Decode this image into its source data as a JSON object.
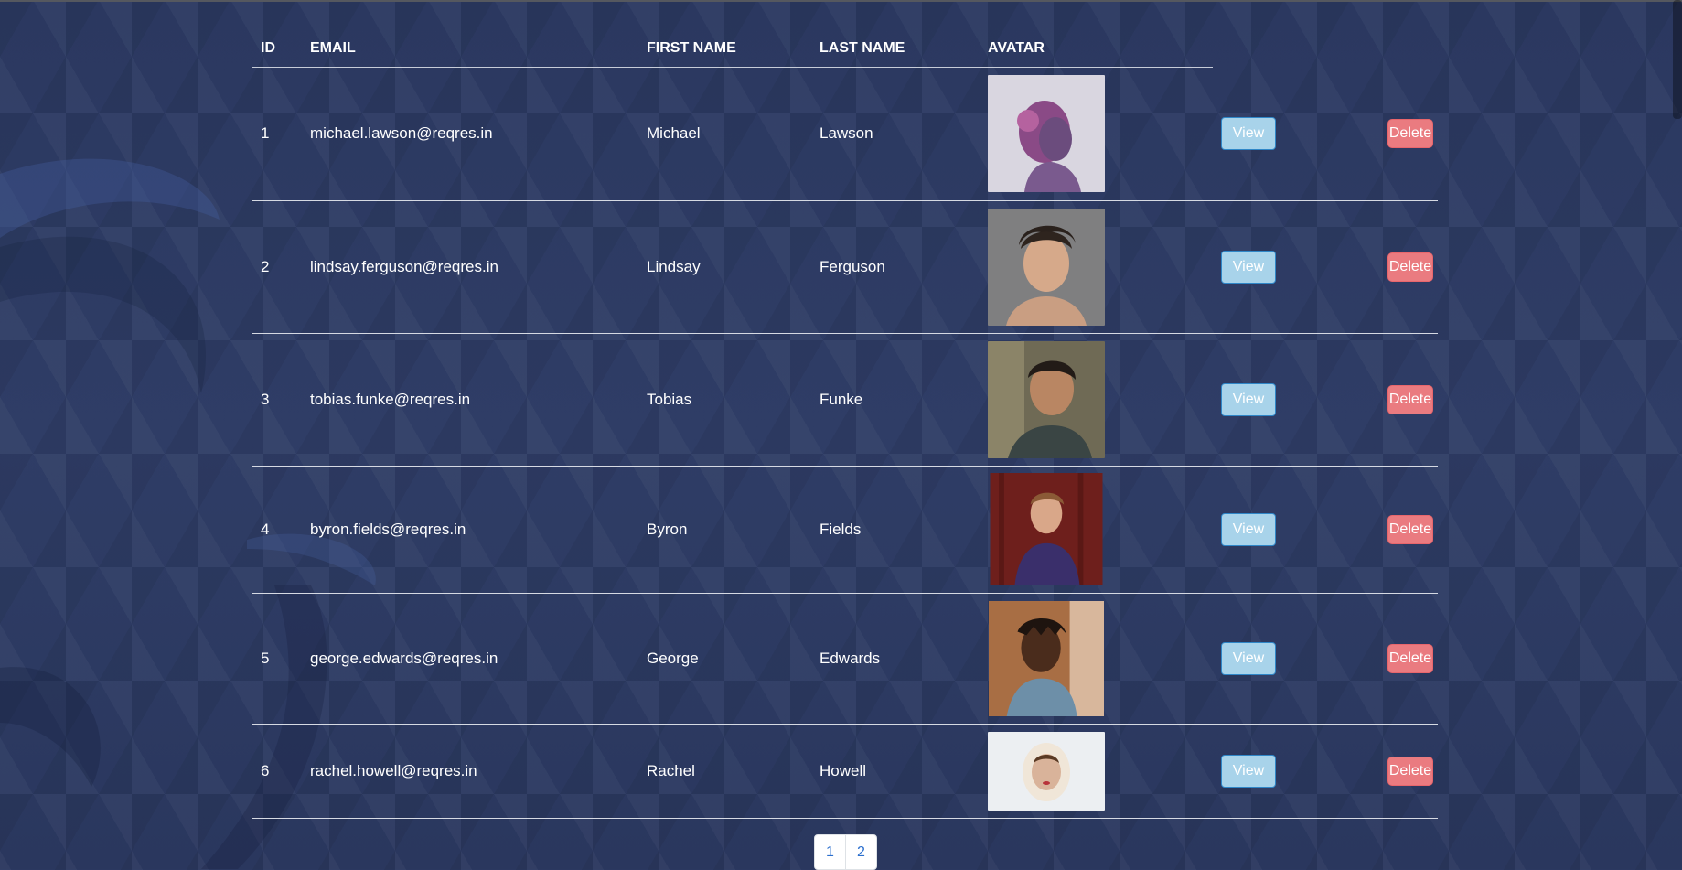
{
  "table": {
    "headers": {
      "id": "ID",
      "email": "EMAIL",
      "first_name": "FIRST NAME",
      "last_name": "LAST NAME",
      "avatar": "AVATAR"
    },
    "rows": [
      {
        "id": "1",
        "email": "michael.lawson@reqres.in",
        "first_name": "Michael",
        "last_name": "Lawson",
        "view_label": "View",
        "delete_label": "Delete"
      },
      {
        "id": "2",
        "email": "lindsay.ferguson@reqres.in",
        "first_name": "Lindsay",
        "last_name": "Ferguson",
        "view_label": "View",
        "delete_label": "Delete"
      },
      {
        "id": "3",
        "email": "tobias.funke@reqres.in",
        "first_name": "Tobias",
        "last_name": "Funke",
        "view_label": "View",
        "delete_label": "Delete"
      },
      {
        "id": "4",
        "email": "byron.fields@reqres.in",
        "first_name": "Byron",
        "last_name": "Fields",
        "view_label": "View",
        "delete_label": "Delete"
      },
      {
        "id": "5",
        "email": "george.edwards@reqres.in",
        "first_name": "George",
        "last_name": "Edwards",
        "view_label": "View",
        "delete_label": "Delete"
      },
      {
        "id": "6",
        "email": "rachel.howell@reqres.in",
        "first_name": "Rachel",
        "last_name": "Howell",
        "view_label": "View",
        "delete_label": "Delete"
      }
    ]
  },
  "pagination": {
    "pages": [
      "1",
      "2"
    ]
  },
  "colors": {
    "background": "#2d3b63",
    "view_button": "#a8d3ea",
    "delete_button": "#ea7b80",
    "pagination_link": "#2b6fce"
  }
}
